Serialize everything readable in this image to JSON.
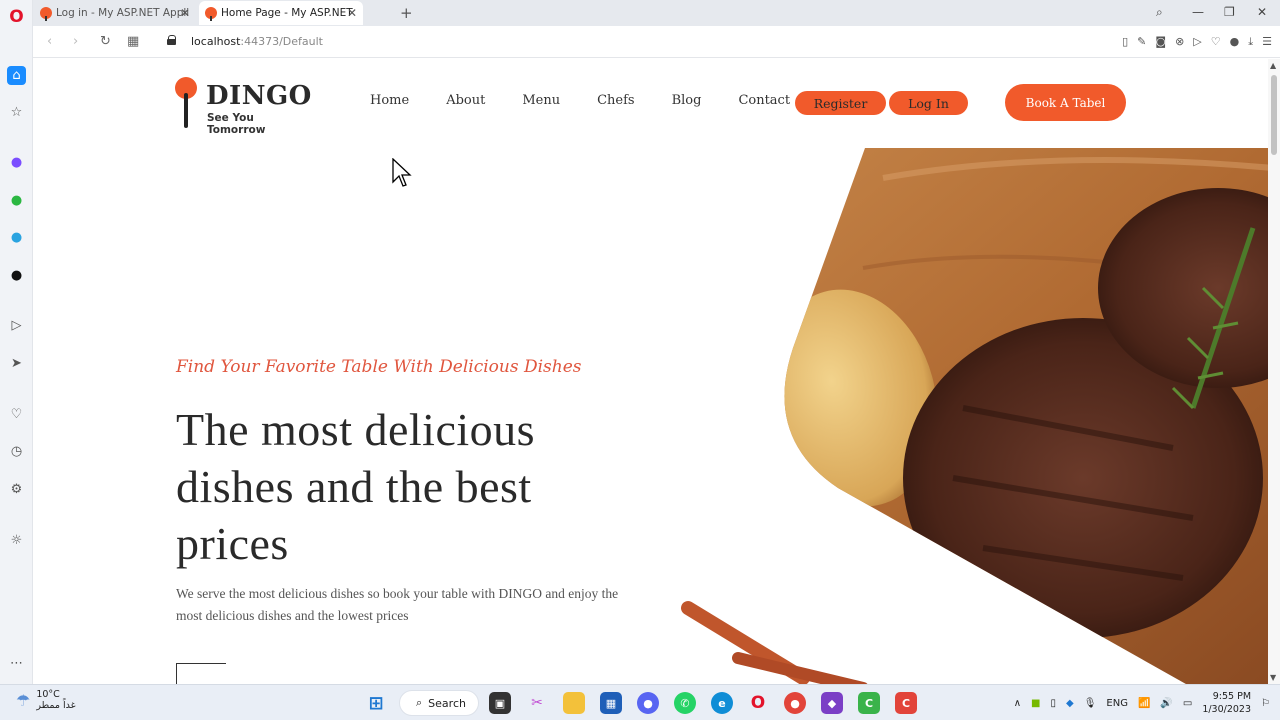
{
  "browser": {
    "tabs": [
      {
        "title": "Log in - My ASP.NET Appli",
        "active": false
      },
      {
        "title": "Home Page - My ASP.NET",
        "active": true
      }
    ],
    "url_host": "localhost",
    "url_rest": ":44373/Default"
  },
  "site": {
    "logo_name": "DINGO",
    "logo_tagline": "See You Tomorrow",
    "nav": [
      "Home",
      "About",
      "Menu",
      "Chefs",
      "Blog",
      "Contact"
    ],
    "register_label": "Register",
    "login_label": "Log In",
    "book_label": "Book A Tabel",
    "brand_color": "#f15a2b"
  },
  "hero": {
    "eyebrow": "Find Your Favorite Table With Delicious Dishes",
    "headline": "The most delicious dishes and the best prices",
    "lead": "We serve the most delicious dishes so book your table with DINGO and enjoy the most delicious dishes and the lowest prices"
  },
  "taskbar": {
    "temperature": "10°C",
    "weather_desc": "غداً ممطر",
    "search_label": "Search",
    "language": "ENG",
    "time": "9:55 PM",
    "date": "1/30/2023"
  }
}
